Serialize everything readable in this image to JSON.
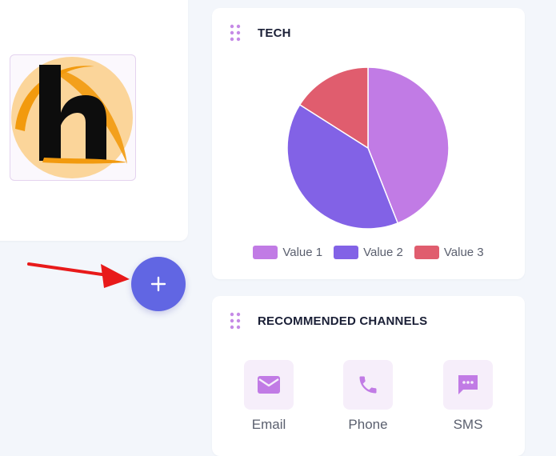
{
  "tech_card": {
    "title": "TECH"
  },
  "chart_data": {
    "type": "pie",
    "title": "TECH",
    "series": [
      {
        "name": "Value 1",
        "value": 44,
        "color": "#c17be5"
      },
      {
        "name": "Value 2",
        "value": 40,
        "color": "#8262e6"
      },
      {
        "name": "Value 3",
        "value": 16,
        "color": "#e05d6e"
      }
    ],
    "legend": "bottom"
  },
  "channels_card": {
    "title": "RECOMMENDED CHANNELS",
    "channels": [
      {
        "label": "Email",
        "icon": "mail-icon"
      },
      {
        "label": "Phone",
        "icon": "phone-icon"
      },
      {
        "label": "SMS",
        "icon": "sms-icon"
      }
    ]
  },
  "fab": {
    "icon": "plus-icon",
    "label": "+"
  },
  "colors": {
    "accent": "#6166e3",
    "channel_icon": "#c17be5",
    "arrow": "#e81a1a",
    "logo_bg": "#fbd59a"
  }
}
